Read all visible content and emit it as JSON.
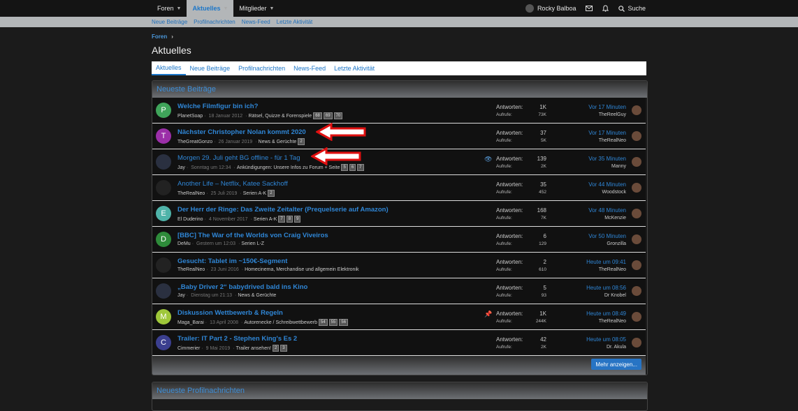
{
  "nav": {
    "tabs": [
      {
        "label": "Foren"
      },
      {
        "label": "Aktuelles"
      },
      {
        "label": "Mitglieder"
      }
    ],
    "user": "Rocky Balboa",
    "search": "Suche"
  },
  "subnav": [
    "Neue Beiträge",
    "Profilnachrichten",
    "News-Feed",
    "Letzte Aktivität"
  ],
  "breadcrumb": "Foren",
  "page_title": "Aktuelles",
  "tabs": [
    "Aktuelles",
    "Neue Beiträge",
    "Profilnachrichten",
    "News-Feed",
    "Letzte Aktivität"
  ],
  "posts_block": {
    "title": "Neueste Beiträge",
    "labels": {
      "replies": "Antworten:",
      "views": "Aufrufe:"
    },
    "more": "Mehr anzeigen...",
    "rows": [
      {
        "avatar": "P",
        "color": "#3fa45a",
        "title": "Welche Filmfigur bin ich?",
        "author": "PlanetSoap",
        "date": "18 Januar 2012",
        "forum": "Rätsel, Quizze & Forenspiele",
        "pages": [
          "68",
          "69",
          "70"
        ],
        "replies": "1K",
        "views": "73K",
        "when": "Vor 17 Minuten",
        "who": "TheReelGuy",
        "bold": true
      },
      {
        "avatar": "T",
        "color": "#9b2fa8",
        "title": "Nächster Christopher Nolan kommt 2020",
        "author": "TheGreatGonzo",
        "date": "26 Januar 2019",
        "forum": "News & Gerüchte",
        "pages": [
          "2"
        ],
        "replies": "37",
        "views": "5K",
        "when": "Vor 17 Minuten",
        "who": "TheRealNeo",
        "bold": true
      },
      {
        "avatar": "",
        "color": "#2a3040",
        "title": "Morgen 29. Juli geht BG offline - für 1 Tag",
        "author": "Jay",
        "date": "Sonntag um 12:34",
        "forum": "Ankündigungen: Unsere Infos zu Forum + Seite",
        "pages": [
          "5",
          "6",
          "7"
        ],
        "replies": "139",
        "views": "2K",
        "when": "Vor 35 Minuten",
        "who": "Manny",
        "bold": false
      },
      {
        "avatar": "",
        "color": "#222",
        "title": "Another Life – Netflix, Katee Sackhoff",
        "author": "TheRealNeo",
        "date": "25 Juli 2019",
        "forum": "Serien A-K",
        "pages": [
          "2"
        ],
        "replies": "35",
        "views": "452",
        "when": "Vor 44 Minuten",
        "who": "Woodstock",
        "bold": false
      },
      {
        "avatar": "E",
        "color": "#4fb3a9",
        "title": "Der Herr der Ringe: Das Zweite Zeitalter (Prequelserie auf Amazon)",
        "author": "El Duderino",
        "date": "4 November 2017",
        "forum": "Serien A-K",
        "pages": [
          "7",
          "8",
          "9"
        ],
        "replies": "168",
        "views": "7K",
        "when": "Vor 48 Minuten",
        "who": "McKenzie",
        "bold": true
      },
      {
        "avatar": "D",
        "color": "#2e8b3a",
        "title": "[BBC] The War of the Worlds von Craig Viveiros",
        "author": "DeMu",
        "date": "Gestern um 12:03",
        "forum": "Serien L-Z",
        "pages": [],
        "replies": "6",
        "views": "129",
        "when": "Vor 50 Minuten",
        "who": "Gronzilla",
        "bold": true
      },
      {
        "avatar": "",
        "color": "#222",
        "title": "Gesucht: Tablet im ~150€-Segment",
        "author": "TheRealNeo",
        "date": "23 Juni 2016",
        "forum": "Homecinema, Merchandise und allgemein Elektronik",
        "pages": [],
        "replies": "2",
        "views": "610",
        "when": "Heute um 09:41",
        "who": "TheRealNeo",
        "bold": true
      },
      {
        "avatar": "",
        "color": "#2a3040",
        "title": "„Baby Driver 2“ babydrived bald ins Kino",
        "author": "Jay",
        "date": "Dienstag um 21:13",
        "forum": "News & Gerüchte",
        "pages": [],
        "replies": "5",
        "views": "93",
        "when": "Heute um 08:56",
        "who": "Dr Knobel",
        "bold": true
      },
      {
        "avatar": "M",
        "color": "#9fc73a",
        "title": "Diskussion Wettbewerb & Regeln",
        "author": "Maga_Barai",
        "date": "13 April 2008",
        "forum": "Autorenecke / Schreibwettbewerb",
        "pages": [
          "54",
          "55",
          "56"
        ],
        "replies": "1K",
        "views": "244K",
        "when": "Heute um 08:49",
        "who": "TheRealNeo",
        "bold": true
      },
      {
        "avatar": "C",
        "color": "#3b3f8f",
        "title": "Trailer: IT Part 2 - Stephen King's Es 2",
        "author": "Cimmerier",
        "date": "9 Mai 2019",
        "forum": "Trailer ansehen!",
        "pages": [
          "2",
          "3"
        ],
        "replies": "42",
        "views": "2K",
        "when": "Heute um 08:05",
        "who": "Dr. Akula",
        "bold": true
      }
    ]
  },
  "profile_block": {
    "title": "Neueste Profilnachrichten"
  }
}
